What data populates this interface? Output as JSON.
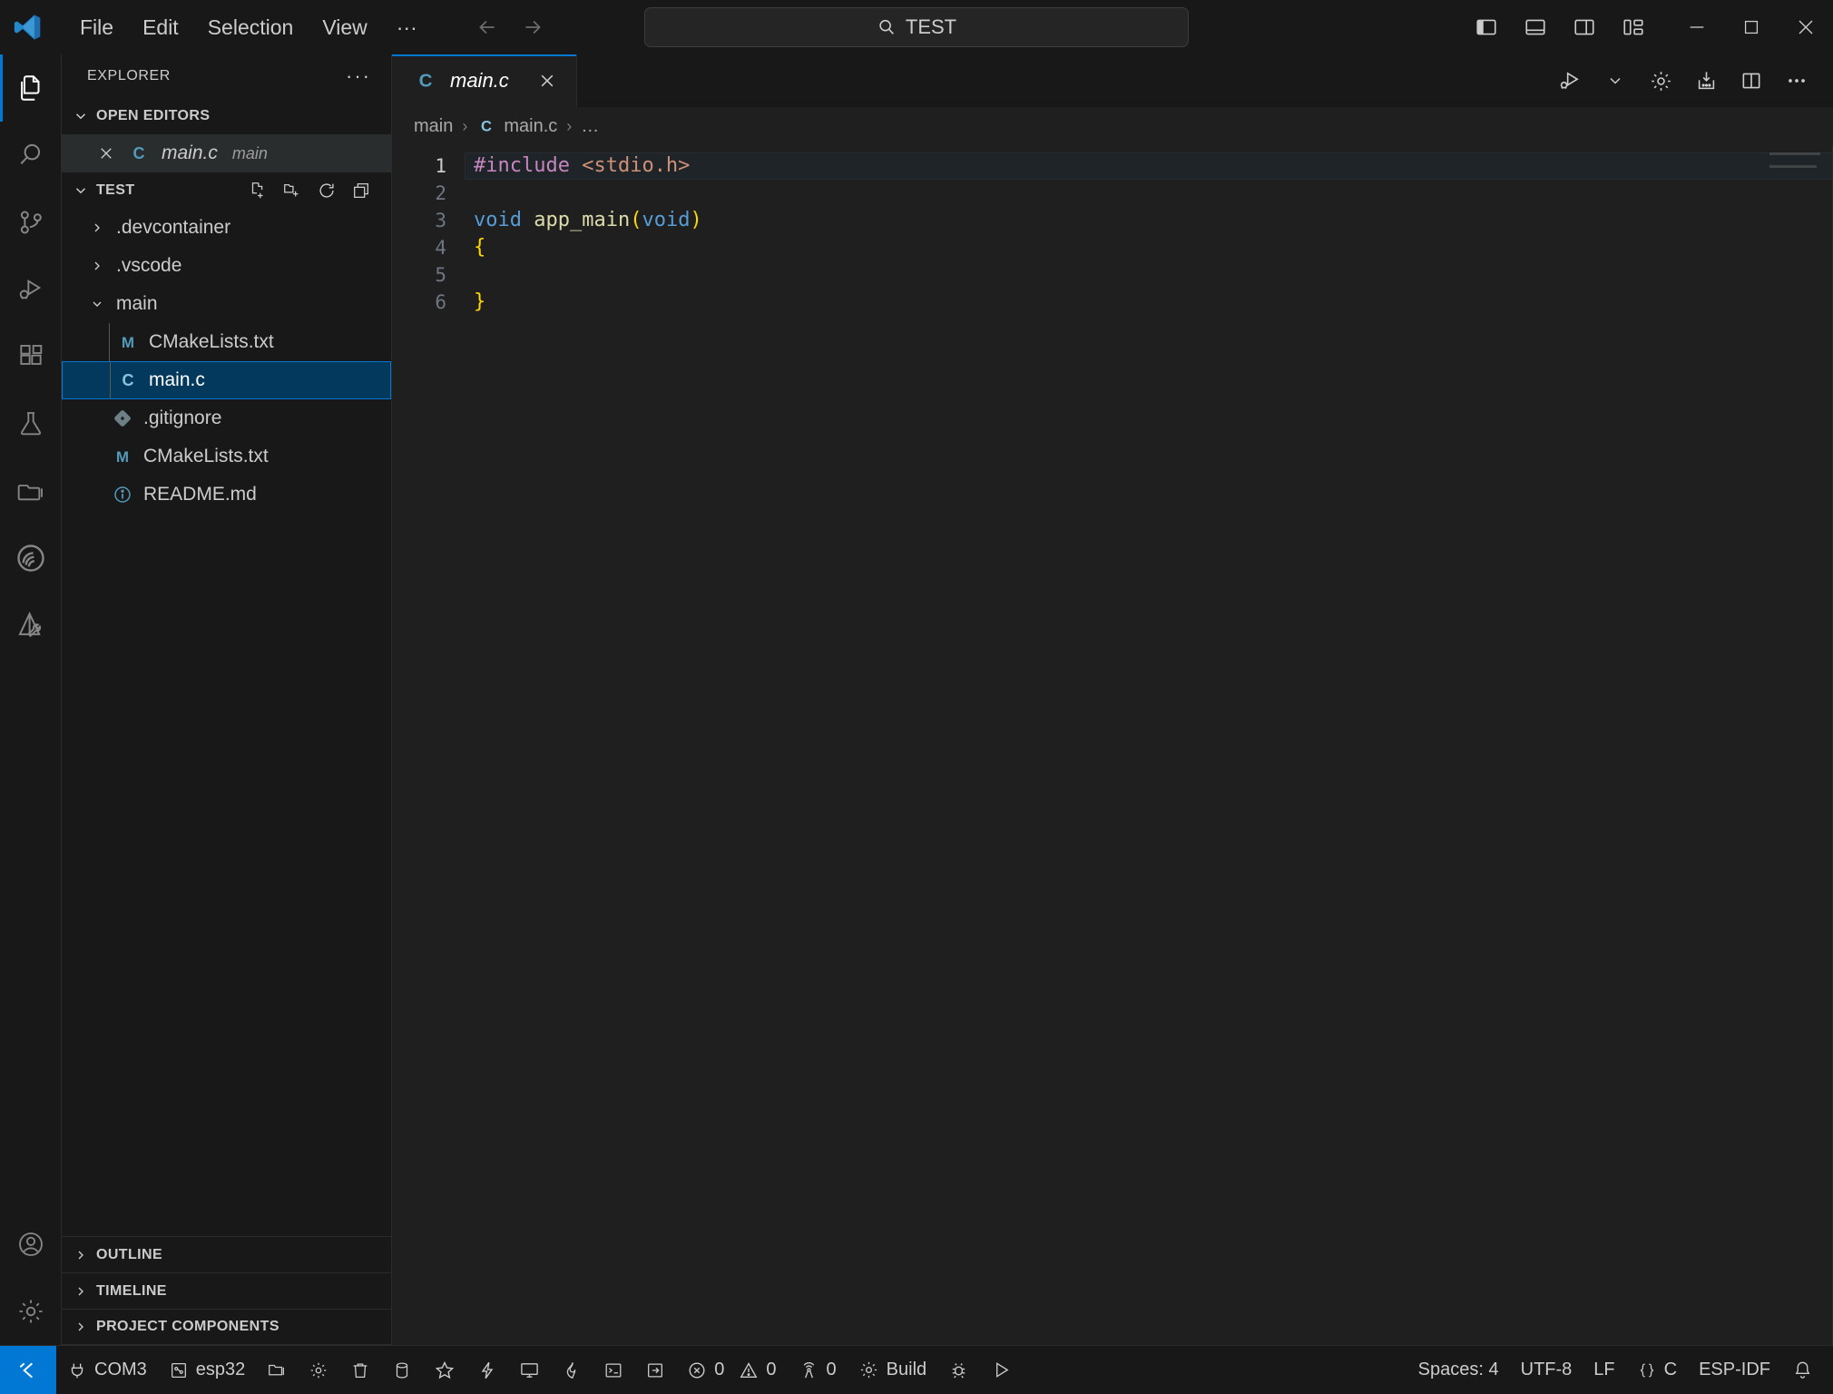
{
  "titlebar": {
    "logo_icon": "vscode-logo-icon",
    "menus": [
      "File",
      "Edit",
      "Selection",
      "View",
      "···"
    ],
    "nav_back_icon": "arrow-left-icon",
    "nav_forward_icon": "arrow-right-icon",
    "command_center": {
      "icon": "search-icon",
      "value": "TEST",
      "placeholder": "Search"
    },
    "layout_controls": [
      {
        "name": "toggle-primary-sidebar",
        "icon": "layout-sidebar-left-icon"
      },
      {
        "name": "toggle-panel",
        "icon": "layout-panel-icon"
      },
      {
        "name": "toggle-secondary-sidebar",
        "icon": "layout-sidebar-right-icon"
      },
      {
        "name": "customize-layout",
        "icon": "layout-customize-icon"
      }
    ],
    "window_controls": [
      {
        "name": "minimize-button",
        "icon": "minimize-icon"
      },
      {
        "name": "maximize-button",
        "icon": "maximize-icon"
      },
      {
        "name": "close-button",
        "icon": "close-icon"
      }
    ]
  },
  "activitybar": {
    "items": [
      {
        "name": "explorer",
        "icon": "files-icon",
        "active": true
      },
      {
        "name": "search",
        "icon": "search-icon",
        "active": false
      },
      {
        "name": "source-control",
        "icon": "source-control-icon",
        "active": false
      },
      {
        "name": "run-and-debug",
        "icon": "run-debug-icon",
        "active": false
      },
      {
        "name": "extensions",
        "icon": "extensions-icon",
        "active": false
      },
      {
        "name": "testing",
        "icon": "beaker-icon",
        "active": false
      },
      {
        "name": "file-browser",
        "icon": "folder-library-icon",
        "active": false
      },
      {
        "name": "esp-idf",
        "icon": "espressif-logo-icon",
        "active": false
      },
      {
        "name": "esp-idf-tools",
        "icon": "esp-tools-icon",
        "active": false
      }
    ],
    "bottom_items": [
      {
        "name": "accounts",
        "icon": "account-icon"
      },
      {
        "name": "manage-settings",
        "icon": "gear-icon"
      }
    ]
  },
  "sidebar": {
    "title": "EXPLORER",
    "more_actions_icon": "ellipsis-icon",
    "open_editors": {
      "label": "OPEN EDITORS",
      "expanded": true,
      "items": [
        {
          "name": "main.c",
          "description": "main",
          "icon": "c-file-icon",
          "close_icon": "close-icon",
          "active": true
        }
      ]
    },
    "folder": {
      "label": "TEST",
      "expanded": true,
      "actions": [
        {
          "name": "new-file-button",
          "icon": "new-file-icon"
        },
        {
          "name": "new-folder-button",
          "icon": "new-folder-icon"
        },
        {
          "name": "refresh-explorer-button",
          "icon": "refresh-icon"
        },
        {
          "name": "collapse-folders-button",
          "icon": "collapse-all-icon"
        }
      ],
      "tree": [
        {
          "label": ".devcontainer",
          "type": "folder",
          "expanded": false,
          "depth": 1,
          "icon": "chevron-right-icon",
          "selected": false
        },
        {
          "label": ".vscode",
          "type": "folder",
          "expanded": false,
          "depth": 1,
          "icon": "chevron-right-icon",
          "selected": false
        },
        {
          "label": "main",
          "type": "folder",
          "expanded": true,
          "depth": 1,
          "icon": "chevron-down-icon",
          "selected": false
        },
        {
          "label": "CMakeLists.txt",
          "type": "file",
          "depth": 2,
          "icon": "cmake-file-icon",
          "selected": false
        },
        {
          "label": "main.c",
          "type": "file",
          "depth": 2,
          "icon": "c-file-icon",
          "selected": true
        },
        {
          "label": ".gitignore",
          "type": "file",
          "depth": 1,
          "icon": "git-file-icon",
          "selected": false
        },
        {
          "label": "CMakeLists.txt",
          "type": "file",
          "depth": 1,
          "icon": "cmake-file-icon",
          "selected": false
        },
        {
          "label": "README.md",
          "type": "file",
          "depth": 1,
          "icon": "readme-info-icon",
          "selected": false
        }
      ]
    },
    "collapsed_sections": [
      {
        "label": "OUTLINE",
        "icon": "chevron-right-icon"
      },
      {
        "label": "TIMELINE",
        "icon": "chevron-right-icon"
      },
      {
        "label": "PROJECT COMPONENTS",
        "icon": "chevron-right-icon"
      }
    ]
  },
  "editor": {
    "tabs": [
      {
        "label": "main.c",
        "icon": "c-file-icon",
        "active": true,
        "preview": true,
        "close_icon": "close-icon"
      }
    ],
    "actions": [
      {
        "name": "run-or-debug-button",
        "icon": "run-debug-play-icon"
      },
      {
        "name": "run-dropdown-button",
        "icon": "chevron-down-icon"
      },
      {
        "name": "editor-settings-button",
        "icon": "gear-icon"
      },
      {
        "name": "flash-device-button",
        "icon": "flash-download-icon"
      },
      {
        "name": "split-editor-button",
        "icon": "split-editor-icon"
      },
      {
        "name": "editor-more-actions-button",
        "icon": "ellipsis-icon"
      }
    ],
    "breadcrumb": [
      {
        "label": "main",
        "icon": null
      },
      {
        "label": "main.c",
        "icon": "c-file-icon"
      },
      {
        "label": "…",
        "icon": null
      }
    ],
    "breadcrumb_separator": "›",
    "code": {
      "language": "C",
      "active_line": 1,
      "lines": [
        {
          "n": "1",
          "tokens": [
            {
              "t": "#include ",
              "c": "pre"
            },
            {
              "t": "<stdio.h>",
              "c": "str"
            }
          ]
        },
        {
          "n": "2",
          "tokens": []
        },
        {
          "n": "3",
          "tokens": [
            {
              "t": "void",
              "c": "kw"
            },
            {
              "t": " ",
              "c": "plain"
            },
            {
              "t": "app_main",
              "c": "fn"
            },
            {
              "t": "(",
              "c": "br"
            },
            {
              "t": "void",
              "c": "kw"
            },
            {
              "t": ")",
              "c": "br"
            }
          ]
        },
        {
          "n": "4",
          "tokens": [
            {
              "t": "{",
              "c": "br"
            }
          ]
        },
        {
          "n": "5",
          "tokens": []
        },
        {
          "n": "6",
          "tokens": [
            {
              "t": "}",
              "c": "br"
            }
          ]
        }
      ]
    }
  },
  "statusbar": {
    "remote": {
      "label": "",
      "icon": "remote-window-icon"
    },
    "left_items": [
      {
        "label": "COM3",
        "icon": "plug-icon"
      },
      {
        "label": "esp32",
        "icon": "chip-icon"
      },
      {
        "label": "",
        "icon": "folder-open-icon"
      },
      {
        "label": "",
        "icon": "gear-icon"
      },
      {
        "label": "",
        "icon": "trash-icon"
      },
      {
        "label": "",
        "icon": "database-icon"
      },
      {
        "label": "",
        "icon": "star-icon"
      },
      {
        "label": "",
        "icon": "zap-icon"
      },
      {
        "label": "",
        "icon": "monitor-icon"
      },
      {
        "label": "",
        "icon": "flame-icon"
      },
      {
        "label": "",
        "icon": "terminal-icon"
      },
      {
        "label": "",
        "icon": "arrow-into-box-icon"
      },
      {
        "label": "0",
        "icon": "error-icon",
        "second_label": "0",
        "second_icon": "warning-icon"
      },
      {
        "label": "0",
        "icon": "radio-tower-icon"
      },
      {
        "label": "Build",
        "icon": "gear-icon"
      },
      {
        "label": "",
        "icon": "bug-icon"
      },
      {
        "label": "",
        "icon": "play-icon"
      }
    ],
    "right_items": [
      {
        "label": "Spaces: 4",
        "name": "indentation-status"
      },
      {
        "label": "UTF-8",
        "name": "encoding-status"
      },
      {
        "label": "LF",
        "name": "eol-status"
      },
      {
        "label": "C",
        "icon": "braces-icon",
        "name": "language-mode-status"
      },
      {
        "label": "ESP-IDF",
        "name": "esp-idf-status"
      },
      {
        "label": "",
        "icon": "bell-icon",
        "name": "notifications-status"
      }
    ]
  },
  "colors": {
    "accent": "#0078d4",
    "titlebar_bg": "#181818",
    "editor_bg": "#1f1f1f",
    "selection_bg": "#04395e",
    "token_preprocessor": "#c586c0",
    "token_string": "#ce9178",
    "token_keyword": "#569cd6",
    "token_function": "#dcdcaa",
    "token_bracket": "#ffd700"
  }
}
